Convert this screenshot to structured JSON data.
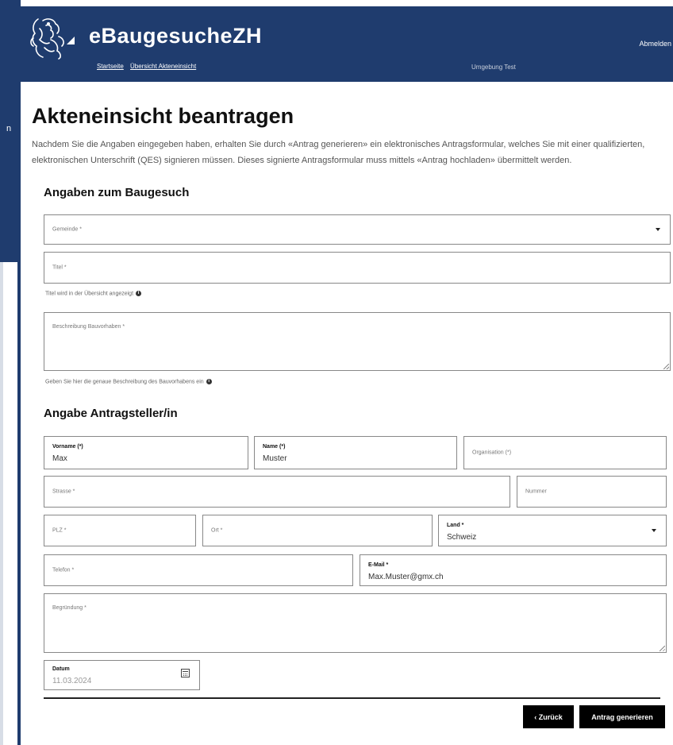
{
  "background": {
    "side_text": "n"
  },
  "header": {
    "app_title": "eBaugesucheZH",
    "nav": [
      "Startseite",
      "Übersicht Akteneinsicht"
    ],
    "environment": "Umgebung Test",
    "logout": "Abmelden"
  },
  "page": {
    "title": "Akteneinsicht beantragen",
    "intro": "Nachdem Sie die Angaben eingegeben haben, erhalten Sie durch «Antrag generieren» ein elektronisches Antragsformular, welches Sie mit einer qualifizierten, elektronischen Unterschrift (QES) signieren müssen. Dieses signierte Antragsformular muss mittels «Antrag hochladen» übermittelt werden."
  },
  "baugesuch": {
    "section_title": "Angaben zum Baugesuch",
    "gemeinde_label": "Gemeinde *",
    "titel_label": "Titel *",
    "titel_hint": "Titel wird in der Übersicht angezeigt",
    "beschreibung_label": "Beschreibung Bauvorhaben *",
    "beschreibung_hint": "Geben Sie hier die genaue Beschreibung des Bauvorhabens ein"
  },
  "antragsteller": {
    "section_title": "Angabe Antragsteller/in",
    "vorname_label": "Vorname (*)",
    "vorname_value": "Max",
    "name_label": "Name (*)",
    "name_value": "Muster",
    "organisation_label": "Organisation (*)",
    "strasse_label": "Strasse *",
    "nummer_label": "Nummer",
    "plz_label": "PLZ *",
    "ort_label": "Ort *",
    "land_label": "Land *",
    "land_value": "Schweiz",
    "telefon_label": "Telefon *",
    "email_label": "E-Mail *",
    "email_value": "Max.Muster@gmx.ch",
    "begruendung_label": "Begründung *",
    "datum_label": "Datum",
    "datum_value": "11.03.2024"
  },
  "actions": {
    "back_label": "‹ Zurück",
    "generate_label": "Antrag generieren"
  },
  "icons": {
    "info": "info-icon",
    "dropdown": "chevron-down-icon",
    "calendar": "calendar-icon",
    "logo": "zurich-lion-logo-icon"
  },
  "colors": {
    "header_bg": "#1f3c6e",
    "button_bg": "#000000"
  }
}
